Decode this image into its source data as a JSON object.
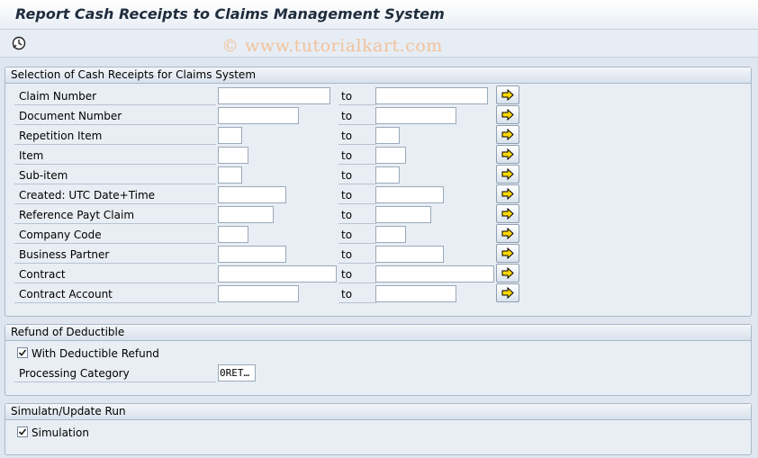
{
  "window": {
    "title": "Report Cash Receipts to Claims Management System"
  },
  "toolbar": {
    "execute_icon": "execute-clock-icon",
    "watermark": "© www.tutorialkart.com"
  },
  "selection": {
    "header": "Selection of Cash Receipts for Claims System",
    "to_label": "to",
    "rows": [
      {
        "label": "Claim Number",
        "from": "",
        "to": ""
      },
      {
        "label": "Document Number",
        "from": "",
        "to": ""
      },
      {
        "label": "Repetition Item",
        "from": "",
        "to": ""
      },
      {
        "label": "Item",
        "from": "",
        "to": ""
      },
      {
        "label": "Sub-item",
        "from": "",
        "to": ""
      },
      {
        "label": "Created: UTC Date+Time",
        "from": "",
        "to": ""
      },
      {
        "label": "Reference Payt Claim",
        "from": "",
        "to": ""
      },
      {
        "label": "Company Code",
        "from": "",
        "to": ""
      },
      {
        "label": "Business Partner",
        "from": "",
        "to": ""
      },
      {
        "label": "Contract",
        "from": "",
        "to": ""
      },
      {
        "label": "Contract Account",
        "from": "",
        "to": ""
      }
    ]
  },
  "refund": {
    "header": "Refund of Deductible",
    "with_refund_label": "With Deductible Refund",
    "with_refund_checked": true,
    "processing_category_label": "Processing Category",
    "processing_category_value": "0RET…"
  },
  "run": {
    "header": "Simulatn/Update Run",
    "simulation_label": "Simulation",
    "simulation_checked": true
  },
  "colors": {
    "arrow_yellow": "#ffd800",
    "frame_border": "#a9b8c9",
    "background": "#dfe6ef"
  }
}
